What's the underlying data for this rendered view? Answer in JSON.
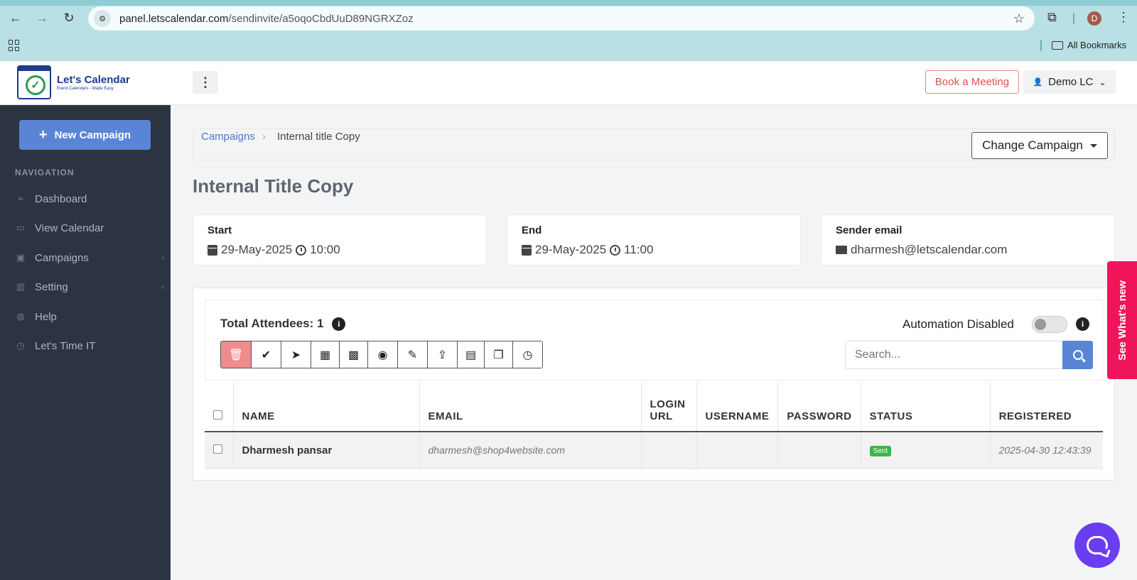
{
  "browser": {
    "url_domain": "panel.letscalendar.com",
    "url_path": "/sendinvite/a5oqoCbdUuD89NGRXZoz",
    "bookmarks_label": "All Bookmarks",
    "profile_initial": "D"
  },
  "header": {
    "logo_title": "Let's Calendar",
    "logo_subtitle": "Event Calendars - Made Easy",
    "book_meeting": "Book a Meeting",
    "user_name": "Demo LC"
  },
  "sidebar": {
    "new_campaign": "New Campaign",
    "heading": "NAVIGATION",
    "items": [
      {
        "label": "Dashboard",
        "icon": "send-icon"
      },
      {
        "label": "View Calendar",
        "icon": "calendar-icon"
      },
      {
        "label": "Campaigns",
        "icon": "book-icon"
      },
      {
        "label": "Setting",
        "icon": "map-icon"
      },
      {
        "label": "Help",
        "icon": "globe-icon"
      },
      {
        "label": "Let's Time IT",
        "icon": "clock-icon"
      }
    ]
  },
  "breadcrumb": {
    "parent": "Campaigns",
    "current": "Internal title Copy"
  },
  "change_campaign": "Change Campaign",
  "page_title": "Internal Title Copy",
  "cards": {
    "start": {
      "label": "Start",
      "date": "29-May-2025",
      "time": "10:00"
    },
    "end": {
      "label": "End",
      "date": "29-May-2025",
      "time": "11:00"
    },
    "sender": {
      "label": "Sender email",
      "value": "dharmesh@letscalendar.com"
    }
  },
  "attendees": {
    "total_label": "Total Attendees: 1",
    "automation_label": "Automation Disabled",
    "automation_enabled": false,
    "search_placeholder": "Search...",
    "toolbar_icons": [
      "trash-icon",
      "check-icon",
      "send-icon",
      "calendar-plus-icon",
      "calendar-x-icon",
      "stop-icon",
      "pencil-icon",
      "upload-icon",
      "excel-icon",
      "copy-icon",
      "clock-icon"
    ]
  },
  "table": {
    "headers": {
      "name": "NAME",
      "email": "EMAIL",
      "login_url_1": "LOGIN",
      "login_url_2": "URL",
      "username": "USERNAME",
      "password": "PASSWORD",
      "status": "STATUS",
      "registered": "REGISTERED"
    },
    "rows": [
      {
        "name": "Dharmesh pansar",
        "email": "dharmesh@shop4website.com",
        "login_url": "",
        "username": "",
        "password": "",
        "status": "Sent",
        "registered": "2025-04-30 12:43:39"
      }
    ]
  },
  "whats_new": "See What's new",
  "colors": {
    "sidebar_bg": "#2c3441",
    "primary": "#5a85d6",
    "danger": "#f08b8e",
    "whats_new": "#f0145a",
    "chat": "#6a3ef0",
    "status_sent": "#3bb54a"
  }
}
